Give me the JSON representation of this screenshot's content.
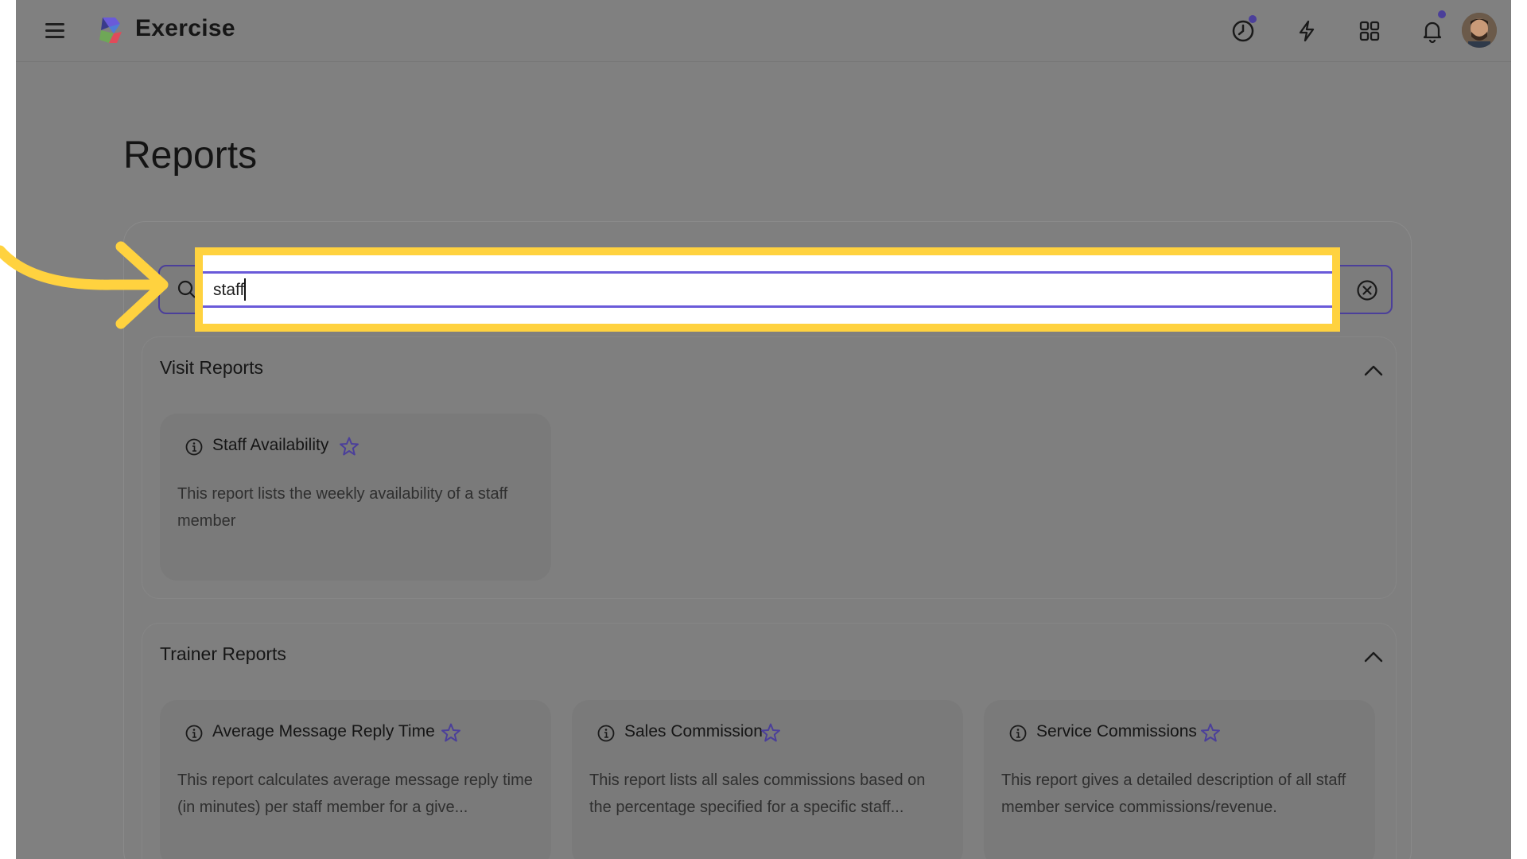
{
  "app": {
    "title": "Exercise",
    "accent_color": "#4b3f9a",
    "highlight_color": "#ffd23f",
    "overlay_color": "#808080"
  },
  "topbar": {
    "icons": [
      "menu-icon",
      "history-icon",
      "lightning-icon",
      "apps-grid-icon",
      "bell-icon",
      "avatar"
    ]
  },
  "page": {
    "title": "Reports"
  },
  "search": {
    "value": "staff",
    "icon": "search-icon",
    "clear_icon": "clear-circle-icon"
  },
  "sections": [
    {
      "title": "Visit Reports",
      "cards": [
        {
          "name": "Staff Availability",
          "description": "This report lists the weekly availability of a staff member"
        }
      ]
    },
    {
      "title": "Trainer Reports",
      "cards": [
        {
          "name": "Average Message Reply Time",
          "description": "This report calculates average message reply time (in minutes) per staff member for a give..."
        },
        {
          "name": "Sales Commission",
          "description": "This report lists all sales commissions based on the percentage specified for a specific staff..."
        },
        {
          "name": "Service Commissions",
          "description": "This report gives a detailed description of all staff member service commissions/revenue."
        }
      ]
    }
  ]
}
